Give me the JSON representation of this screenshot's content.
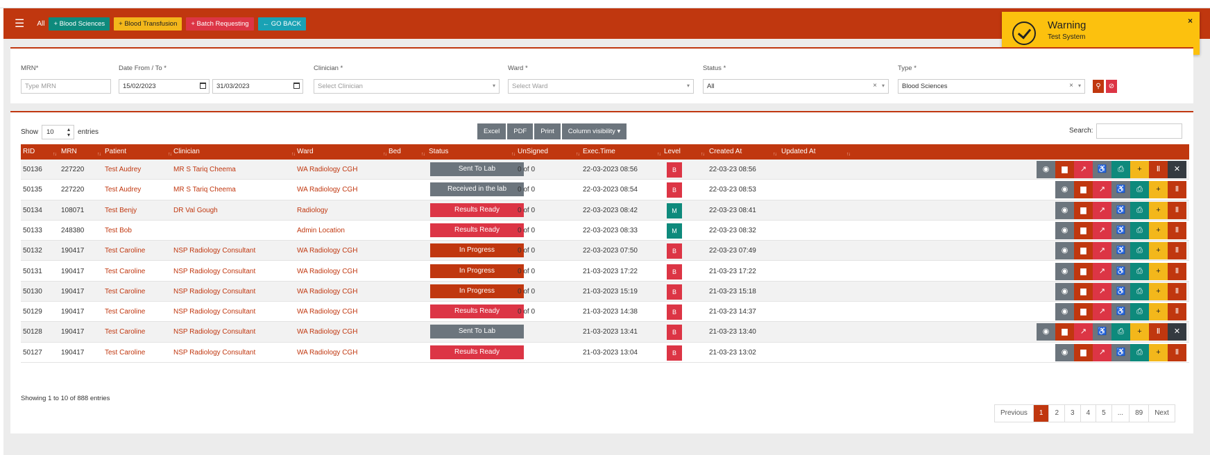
{
  "colors": {
    "primary": "#c0370f",
    "teal": "#0e8a7c",
    "yellow": "#f3b71b",
    "red": "#dc3545",
    "grey": "#6c757d",
    "cyan": "#19a2b4",
    "warning": "#fcc10e"
  },
  "navbar": {
    "menu_icon": "hamburger-icon",
    "all_label": "All",
    "buttons": [
      "+ Blood Sciences",
      "+ Blood Transfusion",
      "+ Batch Requesting",
      "← GO BACK"
    ]
  },
  "toast": {
    "title": "Warning",
    "message": "Test System",
    "icon": "check-circle-icon",
    "close": "×"
  },
  "filters": {
    "mrn": {
      "label": "MRN*",
      "placeholder": "Type MRN"
    },
    "date": {
      "label": "Date From / To *",
      "from": "15/02/2023",
      "to": "31/03/2023"
    },
    "clinician": {
      "label": "Clinician *",
      "placeholder": "Select Clinician"
    },
    "ward": {
      "label": "Ward *",
      "placeholder": "Select Ward"
    },
    "status": {
      "label": "Status *",
      "value": "All"
    },
    "type": {
      "label": "Type *",
      "value": "Blood Sciences"
    },
    "search_icon": "search-icon",
    "reset_icon": "ban-icon"
  },
  "table_controls": {
    "show_label": "Show",
    "entries_value": "10",
    "entries_label": "entries",
    "export_buttons": [
      "Excel",
      "PDF",
      "Print",
      "Column visibility ▾"
    ],
    "search_label": "Search:"
  },
  "table": {
    "columns": [
      "RID",
      "MRN",
      "Patient",
      "Clinician",
      "Ward",
      "Bed",
      "Status",
      "UnSigned",
      "Exec.Time",
      "Level",
      "Created At",
      "Updated At"
    ],
    "rows": [
      {
        "rid": "50136",
        "mrn": "227220",
        "patient": "Test Audrey",
        "clinician": "MR S Tariq Cheema",
        "ward": "WA Radiology CGH",
        "bed": "",
        "status": "Sent To Lab",
        "unsigned": "0 of 0",
        "exec_time": "22-03-2023 08:56",
        "level": "B",
        "created": "22-03-23 08:56",
        "updated": "",
        "extra_actions": true
      },
      {
        "rid": "50135",
        "mrn": "227220",
        "patient": "Test Audrey",
        "clinician": "MR S Tariq Cheema",
        "ward": "WA Radiology CGH",
        "bed": "",
        "status": "Received in the lab",
        "unsigned": "0 of 0",
        "exec_time": "22-03-2023 08:54",
        "level": "B",
        "created": "22-03-23 08:53",
        "updated": "",
        "extra_actions": false
      },
      {
        "rid": "50134",
        "mrn": "108071",
        "patient": "Test Benjy",
        "clinician": "DR Val Gough",
        "ward": "Radiology",
        "bed": "",
        "status": "Results Ready",
        "unsigned": "0 of 0",
        "exec_time": "22-03-2023 08:42",
        "level": "M",
        "created": "22-03-23 08:41",
        "updated": "",
        "extra_actions": false
      },
      {
        "rid": "50133",
        "mrn": "248380",
        "patient": "Test Bob",
        "clinician": "",
        "ward": "Admin Location",
        "bed": "",
        "status": "Results Ready",
        "unsigned": "0 of 0",
        "exec_time": "22-03-2023 08:33",
        "level": "M",
        "created": "22-03-23 08:32",
        "updated": "",
        "extra_actions": false
      },
      {
        "rid": "50132",
        "mrn": "190417",
        "patient": "Test Caroline",
        "clinician": "NSP Radiology Consultant",
        "ward": "WA Radiology CGH",
        "bed": "",
        "status": "In Progress",
        "unsigned": "0 of 0",
        "exec_time": "22-03-2023 07:50",
        "level": "B",
        "created": "22-03-23 07:49",
        "updated": "",
        "extra_actions": false
      },
      {
        "rid": "50131",
        "mrn": "190417",
        "patient": "Test Caroline",
        "clinician": "NSP Radiology Consultant",
        "ward": "WA Radiology CGH",
        "bed": "",
        "status": "In Progress",
        "unsigned": "0 of 0",
        "exec_time": "21-03-2023 17:22",
        "level": "B",
        "created": "21-03-23 17:22",
        "updated": "",
        "extra_actions": false
      },
      {
        "rid": "50130",
        "mrn": "190417",
        "patient": "Test Caroline",
        "clinician": "NSP Radiology Consultant",
        "ward": "WA Radiology CGH",
        "bed": "",
        "status": "In Progress",
        "unsigned": "0 of 0",
        "exec_time": "21-03-2023 15:19",
        "level": "B",
        "created": "21-03-23 15:18",
        "updated": "",
        "extra_actions": false
      },
      {
        "rid": "50129",
        "mrn": "190417",
        "patient": "Test Caroline",
        "clinician": "NSP Radiology Consultant",
        "ward": "WA Radiology CGH",
        "bed": "",
        "status": "Results Ready",
        "unsigned": "0 of 0",
        "exec_time": "21-03-2023 14:38",
        "level": "B",
        "created": "21-03-23 14:37",
        "updated": "",
        "extra_actions": false
      },
      {
        "rid": "50128",
        "mrn": "190417",
        "patient": "Test Caroline",
        "clinician": "NSP Radiology Consultant",
        "ward": "WA Radiology CGH",
        "bed": "",
        "status": "Sent To Lab",
        "unsigned": "",
        "exec_time": "21-03-2023 13:41",
        "level": "B",
        "created": "21-03-23 13:40",
        "updated": "",
        "extra_actions": true
      },
      {
        "rid": "50127",
        "mrn": "190417",
        "patient": "Test Caroline",
        "clinician": "NSP Radiology Consultant",
        "ward": "WA Radiology CGH",
        "bed": "",
        "status": "Results Ready",
        "unsigned": "",
        "exec_time": "21-03-2023 13:04",
        "level": "B",
        "created": "21-03-23 13:02",
        "updated": "",
        "extra_actions": false
      }
    ],
    "action_icons": [
      "eye-icon",
      "bar-chart-icon",
      "line-chart-icon",
      "wheelchair-icon",
      "print-icon",
      "plus-icon",
      "columns-icon"
    ],
    "extra_action_icon": "close-icon"
  },
  "footer": {
    "showing": "Showing 1 to 10 of 888 entries",
    "pages": [
      "Previous",
      "1",
      "2",
      "3",
      "4",
      "5",
      "...",
      "89",
      "Next"
    ],
    "active_page": "1"
  }
}
